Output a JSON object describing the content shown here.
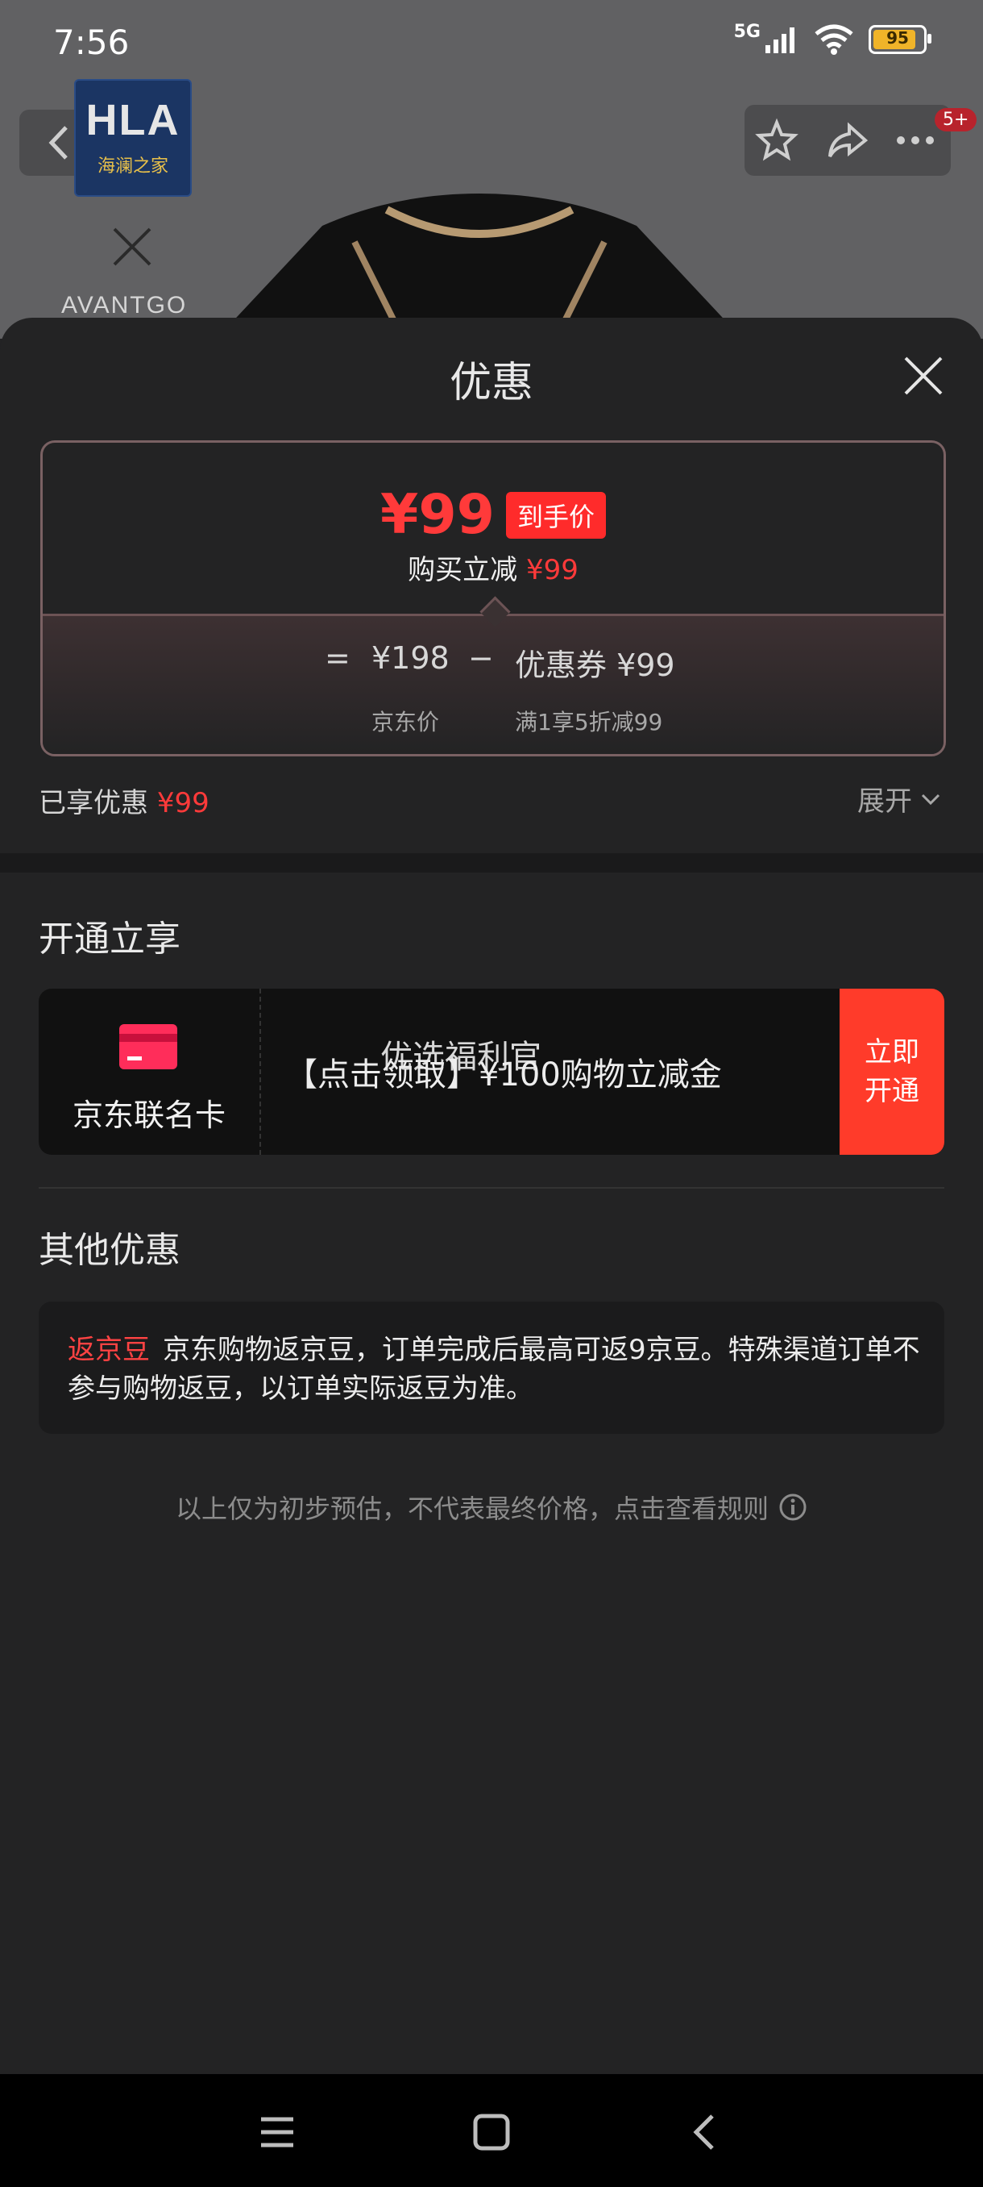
{
  "status_bar": {
    "time": "7:56",
    "network": "5G",
    "battery": "95"
  },
  "background": {
    "brand_logo_text": "HLA",
    "brand_logo_sub": "海澜之家",
    "brand_collab": "AVANTGO",
    "cart_badge": "5+"
  },
  "sheet": {
    "title": "优惠",
    "price_card": {
      "final_price": "¥99",
      "final_price_tag": "到手价",
      "discount_label": "购买立减",
      "discount_value": "¥99",
      "equals": "=",
      "jd_price": "¥198",
      "minus": "−",
      "coupon": "优惠券 ¥99",
      "jd_price_label": "京东价",
      "coupon_rule": "满1享5折减99"
    },
    "enjoyed_label": "已享优惠",
    "enjoyed_value": "¥99",
    "expand_label": "展开",
    "open_section": {
      "title": "开通立享",
      "card_name": "京东联名卡",
      "overlay_text": "优选福利官",
      "description": "【点击领取】¥100购物立减金",
      "button_line1": "立即",
      "button_line2": "开通"
    },
    "other_section": {
      "title": "其他优惠",
      "bean_tag": "返京豆",
      "bean_text": "京东购物返京豆，订单完成后最高可返9京豆。特殊渠道订单不参与购物返豆，以订单实际返豆为准。"
    },
    "footnote": "以上仅为初步预估，不代表最终价格，点击查看规则"
  },
  "colors": {
    "accent_red": "#ff3a3a",
    "button_red": "#ff3b2a",
    "sheet_bg": "#232324"
  }
}
